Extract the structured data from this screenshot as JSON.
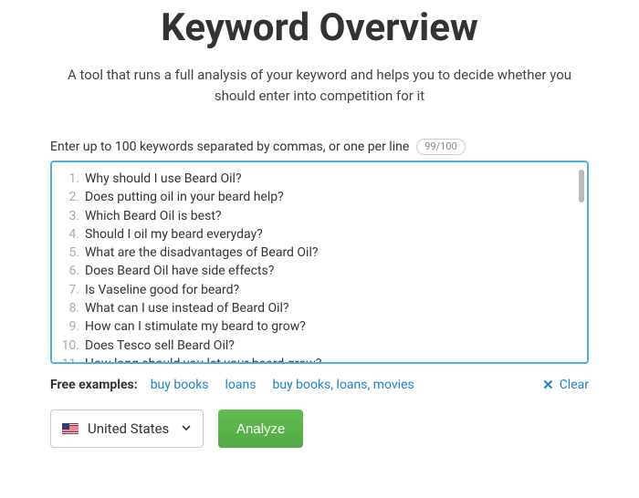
{
  "header": {
    "title": "Keyword Overview",
    "subtitle": "A tool that runs a full analysis of your keyword and helps you to decide whether you should enter into competition for it"
  },
  "input": {
    "prompt": "Enter up to 100 keywords separated by commas, or one per line",
    "counter": "99/100",
    "keywords": [
      "Why should I use Beard Oil?",
      "Does putting oil in your beard help?",
      "Which Beard Oil is best?",
      "Should I oil my beard everyday?",
      "What are the disadvantages of Beard Oil?",
      "Does Beard Oil have side effects?",
      "Is Vaseline good for beard?",
      "What can I use instead of Beard Oil?",
      "How can I stimulate my beard to grow?",
      "Does Tesco sell Beard Oil?",
      "How long should you let your beard grow?"
    ]
  },
  "examples": {
    "label": "Free examples:",
    "items": [
      "buy books",
      "loans",
      "buy books, loans, movies"
    ],
    "clear_label": "Clear"
  },
  "actions": {
    "country": "United States",
    "analyze_label": "Analyze"
  }
}
